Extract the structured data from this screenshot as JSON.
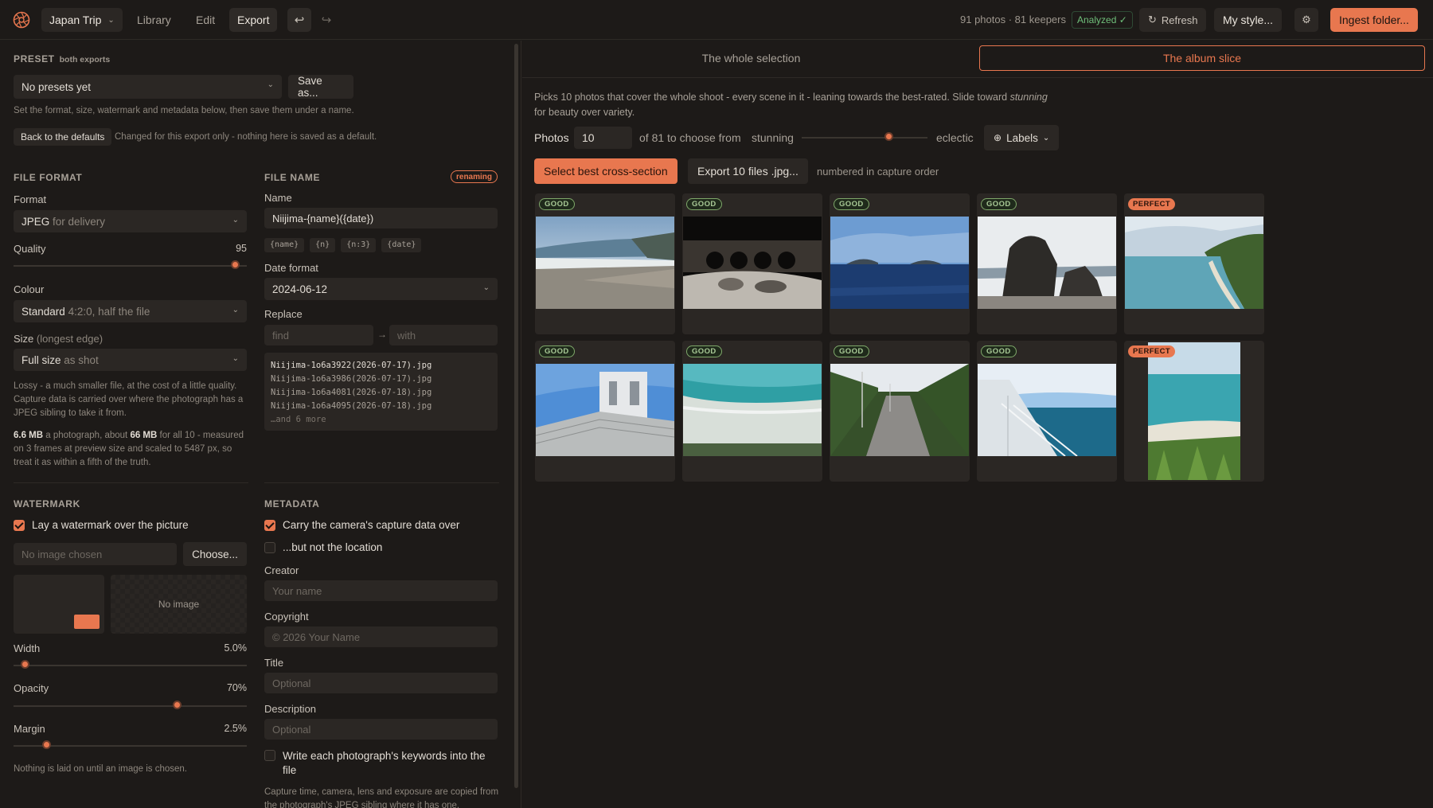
{
  "topbar": {
    "project": "Japan Trip",
    "tabs": [
      "Library",
      "Edit",
      "Export"
    ],
    "active_tab": "Export",
    "stats": "91 photos · 81 keepers",
    "analyzed": "Analyzed ✓",
    "refresh": "Refresh",
    "my_style": "My style...",
    "ingest": "Ingest folder..."
  },
  "preset": {
    "title": "PRESET",
    "subtitle": "both exports",
    "selected": "No presets yet",
    "save_as": "Save as...",
    "help": "Set the format, size, watermark and metadata below, then save them under a name.",
    "back_defaults": "Back to the defaults",
    "back_note": "Changed for this export only - nothing here is saved as a default."
  },
  "file_format": {
    "title": "FILE FORMAT",
    "format_label": "Format",
    "format_value": "JPEG",
    "format_hint": "for delivery",
    "quality_label": "Quality",
    "quality_value": "95",
    "quality_level": 0.95,
    "colour_label": "Colour",
    "colour_value": "Standard",
    "colour_hint": "4:2:0, half the file",
    "size_label": "Size",
    "size_hint": "(longest edge)",
    "size_value": "Full size",
    "size_value_hint": "as shot",
    "note": "Lossy - a much smaller file, at the cost of a little quality. Capture data is carried over where the photograph has a JPEG sibling to take it from.",
    "est_size": "6.6 MB",
    "est_mid": "a photograph, about",
    "est_total": "66 MB",
    "est_tail": "for all 10 - measured on 3 frames at preview size and scaled to 5487 px, so treat it as within a fifth of the truth."
  },
  "file_name": {
    "title": "FILE NAME",
    "badge": "renaming",
    "name_label": "Name",
    "name_value": "Niijima-{name}({date})",
    "tokens": [
      "{name}",
      "{n}",
      "{n:3}",
      "{date}"
    ],
    "date_label": "Date format",
    "date_value": "2024-06-12",
    "replace_label": "Replace",
    "find_placeholder": "find",
    "arrow": "→",
    "with_placeholder": "with",
    "preview": [
      "Niijima-1o6a3922(2026-07-17).jpg",
      "Niijima-1o6a3986(2026-07-17).jpg",
      "Niijima-1o6a4081(2026-07-18).jpg",
      "Niijima-1o6a4095(2026-07-18).jpg",
      "…and 6 more"
    ]
  },
  "watermark": {
    "title": "WATERMARK",
    "enable_label": "Lay a watermark over the picture",
    "enabled": true,
    "image_placeholder": "No image chosen",
    "choose": "Choose...",
    "no_image": "No image",
    "width_label": "Width",
    "width_value": "5.0%",
    "width_level": 0.05,
    "opacity_label": "Opacity",
    "opacity_value": "70%",
    "opacity_level": 0.7,
    "margin_label": "Margin",
    "margin_value": "2.5%",
    "margin_level": 0.14,
    "note": "Nothing is laid on until an image is chosen."
  },
  "metadata": {
    "title": "METADATA",
    "carry_label": "Carry the camera's capture data over",
    "carry": true,
    "no_location_label": "...but not the location",
    "no_location": false,
    "creator_label": "Creator",
    "creator_placeholder": "Your name",
    "copyright_label": "Copyright",
    "copyright_placeholder": "© 2026 Your Name",
    "title_label": "Title",
    "title_placeholder": "Optional",
    "description_label": "Description",
    "description_placeholder": "Optional",
    "keywords_label": "Write each photograph's keywords into the file",
    "keywords": false,
    "footer": "Capture time, camera, lens and exposure are copied from the photograph's JPEG sibling where it has one."
  },
  "right": {
    "segments": [
      "The whole selection",
      "The album slice"
    ],
    "active_segment": "The album slice",
    "desc_1": "Picks 10 photos that cover the whole shoot - every scene in it - leaning towards the best-rated. Slide toward",
    "desc_em": "stunning",
    "desc_2": "for beauty over variety.",
    "photos_label": "Photos",
    "photos_value": "10",
    "of_text": "of 81 to choose from",
    "stunning": "stunning",
    "eclectic": "eclectic",
    "slider_level": 0.69,
    "labels_btn": "Labels",
    "select_best": "Select best cross-section",
    "export_btn": "Export 10 files .jpg...",
    "order_note": "numbered in capture order",
    "thumbs": [
      {
        "badge": "GOOD",
        "kind": "good",
        "scene": "beach-cloudy"
      },
      {
        "badge": "GOOD",
        "kind": "good",
        "scene": "night-arches"
      },
      {
        "badge": "GOOD",
        "kind": "good",
        "scene": "sea-islands"
      },
      {
        "badge": "GOOD",
        "kind": "good",
        "scene": "rocks"
      },
      {
        "badge": "PERFECT",
        "kind": "perfect",
        "scene": "coast-bay"
      },
      {
        "badge": "GOOD",
        "kind": "good",
        "scene": "building-steps"
      },
      {
        "badge": "GOOD",
        "kind": "good",
        "scene": "turquoise-beach"
      },
      {
        "badge": "GOOD",
        "kind": "good",
        "scene": "road"
      },
      {
        "badge": "GOOD",
        "kind": "good",
        "scene": "ferry-deck"
      },
      {
        "badge": "PERFECT",
        "kind": "perfect",
        "scene": "beach-portrait"
      }
    ]
  },
  "colors": {
    "accent": "#e8774f",
    "background": "#1d1a18",
    "panel": "#2b2724",
    "good": "#a8c996"
  }
}
